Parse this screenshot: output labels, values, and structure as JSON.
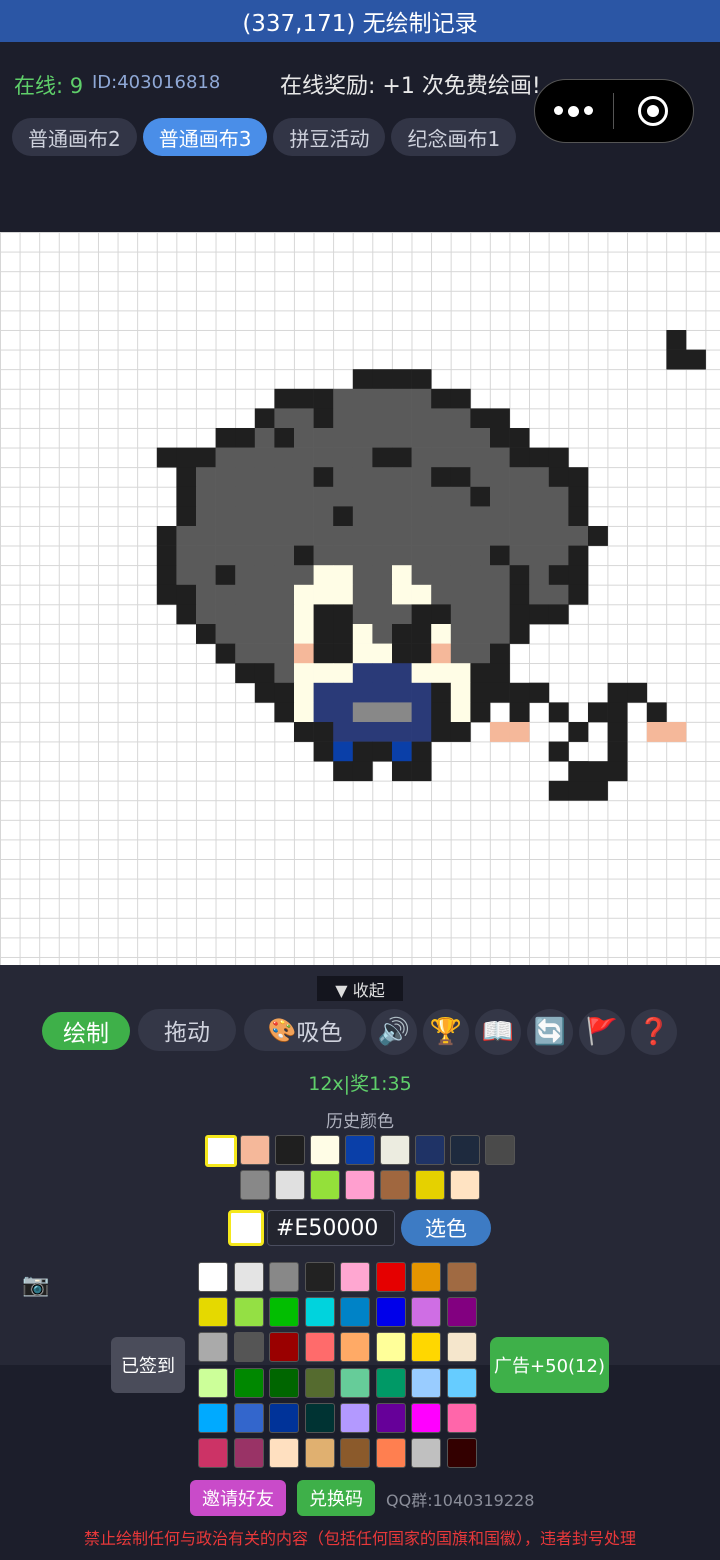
{
  "topbar": {
    "title": "(337,171) 无绘制记录"
  },
  "header": {
    "online": "在线: 9",
    "user_id": "ID:403016818",
    "reward": "在线奖励: +1 次免费绘画!",
    "tabs": [
      "普通画布2",
      "普通画布3",
      "拼豆活动",
      "纪念画布1"
    ],
    "active_tab": 1
  },
  "capsule": {
    "more_icon": "more-dots-icon",
    "close_icon": "target-icon"
  },
  "canvas": {
    "palette": {
      "K": "#1f1f1f",
      "G": "#5a5a5a",
      "C": "#fffde6",
      "P": "#f5b89a",
      "N": "#2a3a78",
      "B": "#0a3fa8",
      "S": "#888888"
    },
    "rows": [
      "..............................K.",
      "..............................KK",
      "..............KKKK..............",
      "..........KKKGGGGGKK............",
      ".........KGGKGGGGGGGKK..........",
      ".......KKGKGGGGGGGGGGKK.........",
      "....KKKGGGGGGGGKKGGGGGKKK.......",
      ".....KGGGGGGKGGGGGKKGGGGKK......",
      ".....KGGGGGGGGGGGGGGKGGGGK......",
      ".....KGGGGGGGKGGGGGGGGGGGK......",
      "....KGGGGGGGGGGGGGGGGGGGGGK.....",
      "....KGGGGGGKGGGGGGGGGKGGGK......",
      "....KGGKGGGGCCGGCGGGGGKGKK......",
      "....KKGGGGGCCCGGCCGGGGKGGK......",
      ".....KGGGGGCKKGGGKKGGGKKK.......",
      "......KGGGGCKKCGKKCGGGK.........",
      ".......KGGGPKKCCKKPGGK..........",
      "........KKGCCCNNNCCCKK..........",
      ".........KKCNNNNNNKCKKKK...K.....",
      "..........KCNNSSSNKCK.....K.....",
      "...........KKNNNNNKK.....K.K....",
      "............KBKKBK......K.......",
      ".............KK.KK.......K.K.....",
      "........................KKK......"
    ],
    "extra_marks": [
      {
        "col": 23,
        "row": 18,
        "c": "K"
      },
      {
        "col": 22,
        "row": 19,
        "c": "K"
      },
      {
        "col": 24,
        "row": 19,
        "c": "K"
      },
      {
        "col": 21,
        "row": 20,
        "c": "P"
      },
      {
        "col": 22,
        "row": 20,
        "c": "P"
      },
      {
        "col": 28,
        "row": 18,
        "c": "K"
      },
      {
        "col": 27,
        "row": 19,
        "c": "K"
      },
      {
        "col": 29,
        "row": 19,
        "c": "K"
      },
      {
        "col": 29,
        "row": 20,
        "c": "P"
      },
      {
        "col": 30,
        "row": 20,
        "c": "P"
      },
      {
        "col": 24,
        "row": 21,
        "c": "K"
      },
      {
        "col": 27,
        "row": 21,
        "c": "K"
      },
      {
        "col": 25,
        "row": 22,
        "c": "K"
      },
      {
        "col": 26,
        "row": 22,
        "c": "K"
      },
      {
        "col": 27,
        "row": 22,
        "c": "K"
      }
    ]
  },
  "panel": {
    "collapse_label": "▼ 收起",
    "draw_label": "绘制",
    "drag_label": "拖动",
    "pick_label": "吸色",
    "pick_icon": "🎨",
    "icons": [
      {
        "name": "sound-icon",
        "glyph": "🔊"
      },
      {
        "name": "trophy-icon",
        "glyph": "🏆"
      },
      {
        "name": "book-icon",
        "glyph": "📖"
      },
      {
        "name": "refresh-icon",
        "glyph": "🔄"
      },
      {
        "name": "flag-icon",
        "glyph": "🚩"
      },
      {
        "name": "help-icon",
        "glyph": "❓"
      }
    ],
    "timer": "12x|奖1:35",
    "history_label": "历史颜色",
    "history_colors": [
      [
        "#ffffff",
        "#f5b89a",
        "#1f1f1f",
        "#fffde6",
        "#0a3fa8",
        "#ecece0",
        "#1f3366",
        "#1e2a3e",
        "#4a4a4a"
      ],
      [
        "#888888",
        "#e0e0e0",
        "#94e03a",
        "#ff9fcf",
        "#a0673f",
        "#e5d100",
        "#ffe3c2"
      ]
    ],
    "current_color": "#ffffff",
    "hex_value": "#E50000",
    "choose_color_label": "选色",
    "camera_icon": "📷",
    "palette_colors": [
      [
        "#ffffff",
        "#e4e4e4",
        "#888888",
        "#222222",
        "#ffa7d1",
        "#e50000",
        "#e59500",
        "#a06a42"
      ],
      [
        "#e5d900",
        "#94e044",
        "#02be01",
        "#00d3dd",
        "#0083c7",
        "#0000ea",
        "#cf6ee4",
        "#820080"
      ],
      [
        "#aaaaaa",
        "#555555",
        "#9a0000",
        "#ff6b6b",
        "#ffaa66",
        "#ffff99",
        "#ffd700",
        "#f5e6cc"
      ],
      [
        "#ccff99",
        "#008800",
        "#006600",
        "#556b2f",
        "#66cc99",
        "#009966",
        "#99ccff",
        "#66ccff"
      ],
      [
        "#00aaff",
        "#3366cc",
        "#003399",
        "#003333",
        "#b399ff",
        "#660099",
        "#ff00ff",
        "#ff66aa"
      ],
      [
        "#cc3366",
        "#993366",
        "#ffe0c0",
        "#e0b070",
        "#8b5a2b",
        "#ff7f50",
        "#c0c0c0",
        "#330000"
      ]
    ],
    "signed_label": "已签到",
    "ad_label": "广告+50(12)",
    "invite_label": "邀请好友",
    "redeem_label": "兑换码",
    "qq_group": "QQ群:1040319228",
    "warning": "禁止绘制任何与政治有关的内容（包括任何国家的国旗和国徽），违者封号处理"
  }
}
